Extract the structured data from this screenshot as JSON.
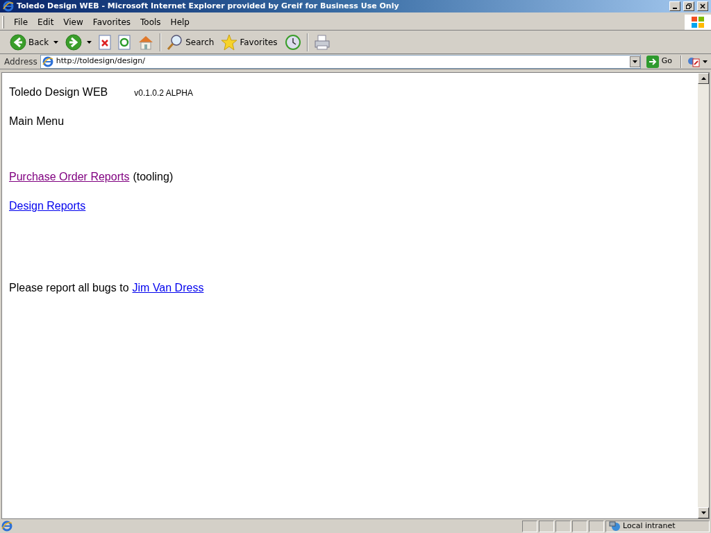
{
  "window": {
    "title": "Toledo Design WEB - Microsoft Internet Explorer provided by Greif for Business Use Only"
  },
  "menu": [
    "File",
    "Edit",
    "View",
    "Favorites",
    "Tools",
    "Help"
  ],
  "toolbar": [
    {
      "kind": "back",
      "label": "Back"
    },
    {
      "kind": "forward"
    },
    {
      "kind": "stop"
    },
    {
      "kind": "refresh"
    },
    {
      "kind": "home"
    },
    {
      "kind": "search",
      "label": "Search"
    },
    {
      "kind": "favorites",
      "label": "Favorites"
    },
    {
      "kind": "history"
    },
    {
      "kind": "print"
    }
  ],
  "address": {
    "label": "Address",
    "value": "http://toldesign/design/",
    "go": "Go"
  },
  "page": {
    "title": "Toledo Design WEB",
    "version": "v0.1.0.2 ALPHA",
    "heading": "Main Menu",
    "links": [
      {
        "text": "Purchase Order Reports",
        "suffix": "(tooling)",
        "visited": true
      },
      {
        "text": "Design Reports",
        "visited": false
      }
    ],
    "footer": {
      "text": "Please report all bugs to",
      "link": "Jim Van Dress"
    }
  },
  "status_bar": {
    "zone": "Local intranet"
  }
}
